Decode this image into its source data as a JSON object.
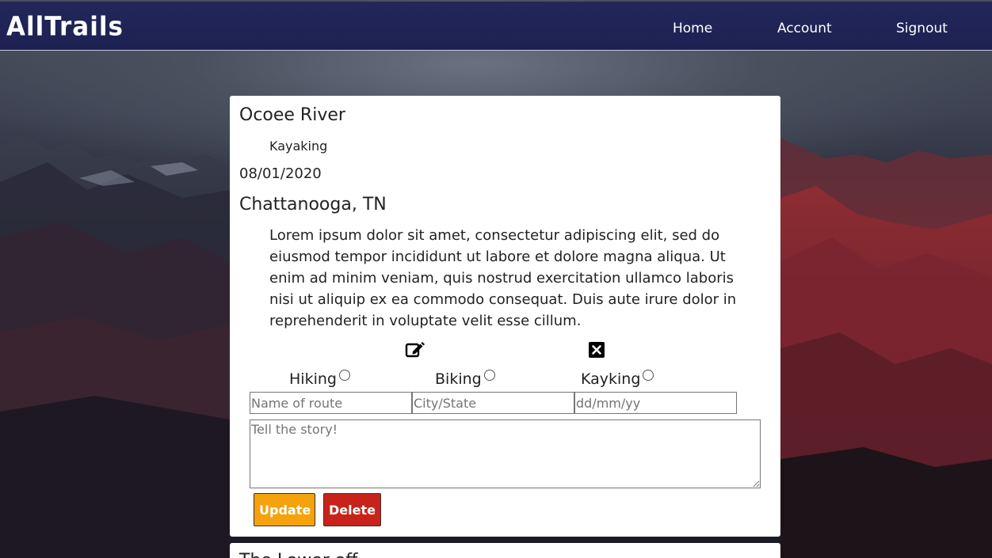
{
  "navbar": {
    "brand": "AllTrails",
    "links": [
      "Home",
      "Account",
      "Signout"
    ]
  },
  "post": {
    "title": "Ocoee River",
    "activity": "Kayaking",
    "date": "08/01/2020",
    "location": "Chattanooga, TN",
    "story": "Lorem ipsum dolor sit amet, consectetur adipiscing elit, sed do eiusmod tempor incididunt ut labore et dolore magna aliqua. Ut enim ad minim veniam, quis nostrud exercitation ullamco laboris nisi ut aliquip ex ea commodo consequat. Duis aute irure dolor in reprehenderit in voluptate velit esse cillum.",
    "icons": {
      "edit": "edit-icon",
      "delete": "close-icon"
    }
  },
  "form": {
    "radios": [
      "Hiking",
      "Biking",
      "Kayking"
    ],
    "route_placeholder": "Name of route",
    "city_placeholder": "City/State",
    "date_placeholder": "dd/mm/yy",
    "story_placeholder": "Tell the story!",
    "update_label": "Update",
    "delete_label": "Delete"
  },
  "next_post": {
    "title": "The Lower off"
  },
  "colors": {
    "navbar": "#1d2152",
    "update_button": "#f5a20c",
    "delete_button": "#c8231a"
  }
}
